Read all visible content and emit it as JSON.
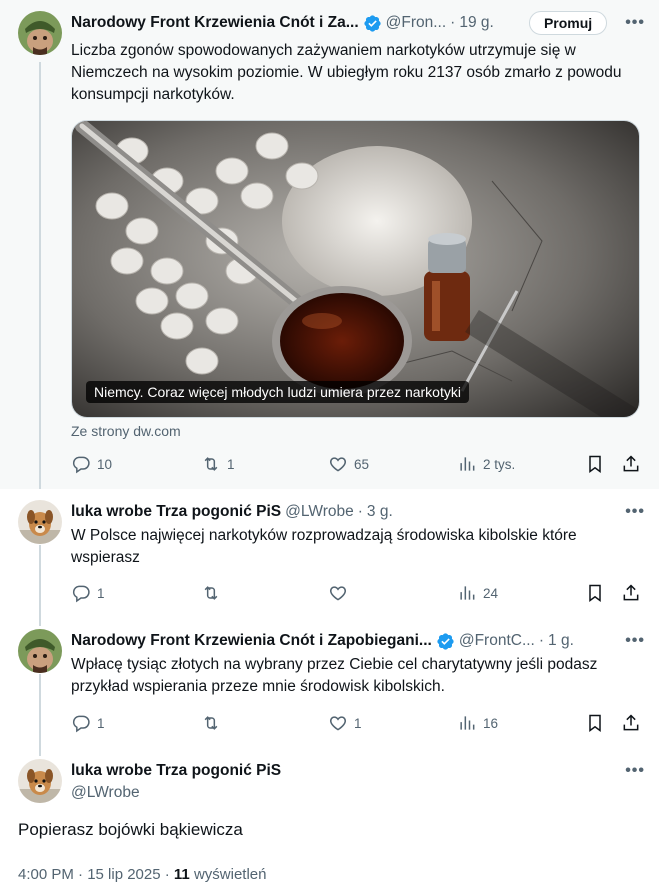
{
  "tweets": [
    {
      "author_name": "Narodowy Front Krzewienia Cnót i Za...",
      "handle": "@Fron...",
      "time": "19 g.",
      "promote_label": "Promuj",
      "text": "Liczba zgonów spowodowanych zażywaniem narkotyków utrzymuje się w Niemczech na wysokim poziomie. W ubiegłym roku 2137 osób zmarło z powodu konsumpcji narkotyków.",
      "media_caption": "Niemcy. Coraz więcej młodych ludzi umiera przez narkotyki",
      "source": "Ze strony dw.com",
      "replies": "10",
      "reposts": "1",
      "likes": "65",
      "views": "2 tys.",
      "verified": true
    },
    {
      "author_name": "luka wrobe Trza pogonić PiS",
      "handle": "@LWrobe",
      "time": "3 g.",
      "text": "W Polsce najwięcej narkotyków rozprowadzają środowiska kibolskie które wspierasz",
      "replies": "1",
      "reposts": "",
      "likes": "",
      "views": "24"
    },
    {
      "author_name": "Narodowy Front Krzewienia Cnót i Zapobiegani...",
      "handle": "@FrontC...",
      "time": "1 g.",
      "text": "Wpłacę tysiąc złotych na wybrany przez Ciebie cel charytatywny jeśli podasz przykład wspierania przeze mnie środowisk kibolskich.",
      "replies": "1",
      "reposts": "",
      "likes": "1",
      "views": "16",
      "verified": true
    },
    {
      "author_name": "luka wrobe Trza pogonić PiS",
      "handle": "@LWrobe",
      "text": "Popierasz bojówki bąkiewicza",
      "timestamp": "4:00 PM · 15 lip 2025 · ",
      "view_count": "11",
      "view_label": " wyświetleń"
    }
  ],
  "more_symbol": "•••",
  "colors": {
    "verified_blue": "#1d9bf0",
    "secondary_text": "#536471",
    "thread_line": "#cfd9de",
    "highlight_bg": "#f7f9f9"
  }
}
